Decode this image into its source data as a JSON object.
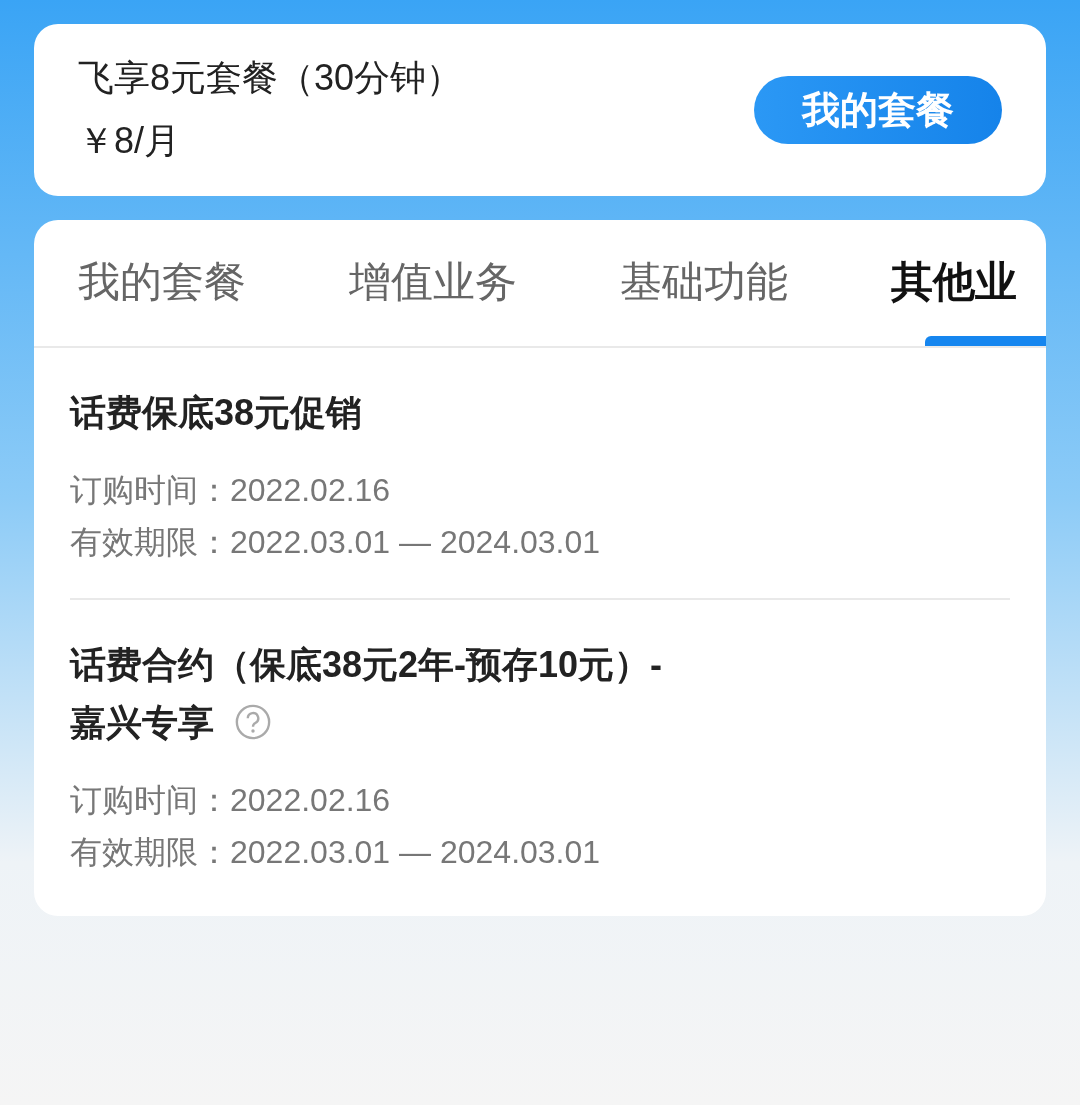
{
  "plan": {
    "name": "飞享8元套餐（30分钟）",
    "price": "￥8/月",
    "button": "我的套餐"
  },
  "tabs": [
    {
      "label": "我的套餐",
      "selected": false
    },
    {
      "label": "增值业务",
      "selected": false
    },
    {
      "label": "基础功能",
      "selected": false
    },
    {
      "label": "其他业",
      "selected": true
    }
  ],
  "services": [
    {
      "title_lines": [
        "话费保底38元促销"
      ],
      "help": false,
      "ordered": "订购时间：2022.02.16",
      "valid": "有效期限：2022.03.01 — 2024.03.01"
    },
    {
      "title_lines": [
        "话费合约（保底38元2年-预存10元）-",
        "嘉兴专享"
      ],
      "help": true,
      "ordered": "订购时间：2022.02.16",
      "valid": "有效期限：2022.03.01 — 2024.03.01"
    }
  ]
}
